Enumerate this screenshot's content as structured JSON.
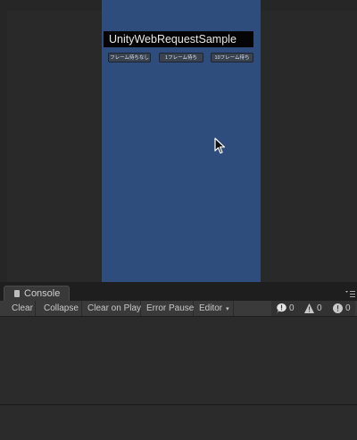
{
  "game": {
    "title": "UnityWebRequestSample",
    "buttons": [
      "フレーム待ちなし",
      "1フレーム待ち",
      "10フレーム待ち"
    ]
  },
  "console": {
    "tab_label": "Console",
    "toolbar": {
      "clear": "Clear",
      "collapse": "Collapse",
      "clear_on_play": "Clear on Play",
      "error_pause": "Error Pause",
      "editor": "Editor"
    },
    "counts": {
      "log": "0",
      "warning": "0",
      "error": "0"
    }
  },
  "colors": {
    "game_background": "#2e4c7c",
    "editor_background": "#2a2a2a"
  },
  "icons": [
    "console-icon",
    "panel-menu-icon",
    "info-icon",
    "warning-icon",
    "error-icon",
    "mouse-cursor-icon"
  ]
}
